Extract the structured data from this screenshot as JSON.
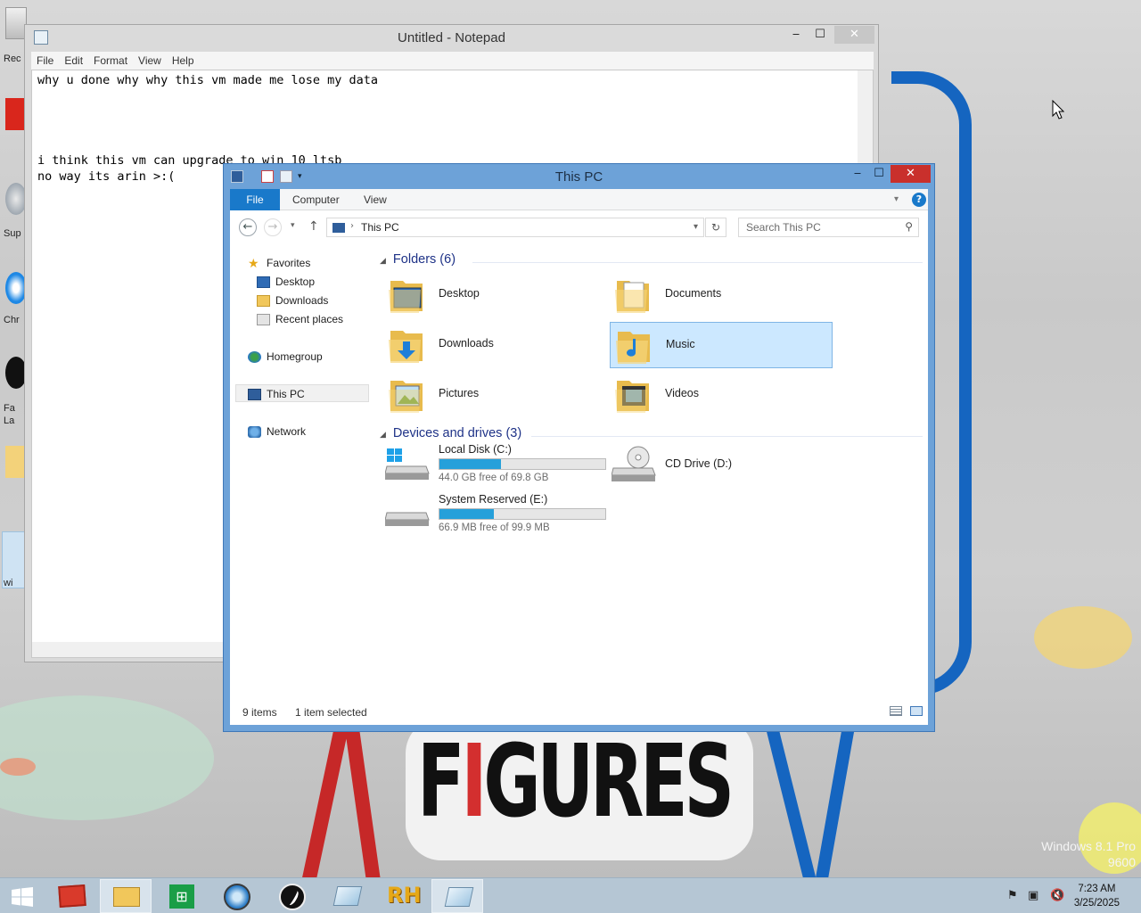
{
  "desktop": {
    "icon_labels": [
      "Rec",
      "Sup",
      "Chr",
      "Fa",
      "La",
      "wi"
    ],
    "wallpaper_word_parts": [
      "F",
      "I",
      "GURES"
    ],
    "os_watermark": "Windows 8.1 Pro",
    "os_build": "9600"
  },
  "notepad": {
    "title": "Untitled - Notepad",
    "menu": [
      "File",
      "Edit",
      "Format",
      "View",
      "Help"
    ],
    "lines": [
      "why u done why why this vm made me lose my data",
      "",
      "",
      "",
      "",
      "i think this vm can upgrade to win 10 ltsb",
      "no way its arin >:("
    ],
    "controls": {
      "minimize": "‒",
      "maximize": "☐",
      "close": "✕"
    }
  },
  "explorer": {
    "title": "This PC",
    "controls": {
      "minimize": "‒",
      "maximize": "☐",
      "close": "✕"
    },
    "ribbon_tabs": [
      "File",
      "Computer",
      "View"
    ],
    "address": "This PC",
    "search_placeholder": "Search This PC",
    "nav": {
      "favorites": "Favorites",
      "desktop": "Desktop",
      "downloads": "Downloads",
      "recent": "Recent places",
      "homegroup": "Homegroup",
      "this_pc": "This PC",
      "network": "Network"
    },
    "folders_header": "Folders (6)",
    "folders": [
      {
        "name": "Desktop",
        "selected": false
      },
      {
        "name": "Documents",
        "selected": false
      },
      {
        "name": "Downloads",
        "selected": false
      },
      {
        "name": "Music",
        "selected": true
      },
      {
        "name": "Pictures",
        "selected": false
      },
      {
        "name": "Videos",
        "selected": false
      }
    ],
    "drives_header": "Devices and drives (3)",
    "drives": [
      {
        "name": "Local Disk (C:)",
        "free": "44.0 GB free of 69.8 GB",
        "used_fraction": 0.37
      },
      {
        "name": "CD Drive (D:)"
      },
      {
        "name": "System Reserved (E:)",
        "free": "66.9 MB free of 99.9 MB",
        "used_fraction": 0.33
      }
    ],
    "status": {
      "items": "9 items",
      "selected": "1 item selected"
    }
  },
  "taskbar": {
    "time": "7:23 AM",
    "date": "3/25/2025",
    "pinned": [
      "start",
      "toolbox",
      "file-explorer",
      "store",
      "ie",
      "app-swirl",
      "notepad",
      "rh",
      "notepad-2"
    ]
  },
  "colors": {
    "explorer_frame": "#6da2d8",
    "file_tab": "#1979ca",
    "close_red": "#c9302c",
    "selection": "#cce8ff",
    "drive_bar": "#26a0da",
    "group_header": "#1e3287"
  }
}
